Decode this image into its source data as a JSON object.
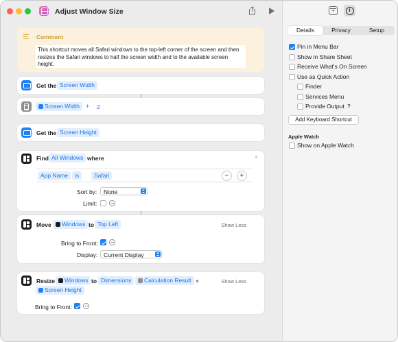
{
  "window": {
    "title": "Adjust Window Size"
  },
  "comment": {
    "title": "Comment",
    "text": "This shortcut moves all Safari windows to the top-left corner of the screen and then resizes the Safari windows to half the screen width and to the available screen height."
  },
  "actions": {
    "get_width": {
      "verb": "Get the",
      "param": "Screen Width"
    },
    "calc": {
      "var": "Screen Width",
      "op": "+",
      "value": "2"
    },
    "get_height": {
      "verb": "Get the",
      "param": "Screen Height"
    },
    "find": {
      "verb": "Find",
      "param": "All Windows",
      "suffix": "where",
      "cond_field": "App Name",
      "cond_op": "is",
      "cond_value": "Safari",
      "minus": "−",
      "plus": "+",
      "sort_label": "Sort by:",
      "sort_value": "None",
      "limit_label": "Limit:",
      "close": "×"
    },
    "move": {
      "verb": "Move",
      "param": "Windows",
      "to": "to",
      "position": "Top Left",
      "show_less": "Show Less",
      "front_label": "Bring to Front:",
      "display_label": "Display:",
      "display_value": "Current Display"
    },
    "resize": {
      "verb": "Resize",
      "param": "Windows",
      "to": "to",
      "mode": "Dimensions",
      "var1": "Calculation Result",
      "times": "×",
      "var2": "Screen Height",
      "show_less": "Show Less",
      "front_label": "Bring to Front:"
    }
  },
  "inspector": {
    "tabs": [
      "Details",
      "Privacy",
      "Setup"
    ],
    "active_tab": "Details",
    "options": {
      "pin_menu_bar": {
        "label": "Pin in Menu Bar",
        "checked": true
      },
      "share_sheet": {
        "label": "Show in Share Sheet",
        "checked": false
      },
      "whats_on_screen": {
        "label": "Receive What's On Screen",
        "checked": false
      },
      "quick_action": {
        "label": "Use as Quick Action",
        "checked": false
      },
      "finder": {
        "label": "Finder",
        "checked": false
      },
      "services_menu": {
        "label": "Services Menu",
        "checked": false
      },
      "provide_output": {
        "label": "Provide Output",
        "checked": false,
        "help": "?"
      }
    },
    "shortcut_button": "Add Keyboard Shortcut",
    "watch_section": "Apple Watch",
    "watch_option": {
      "label": "Show on Apple Watch",
      "checked": false
    }
  },
  "colors": {
    "accent": "#1f82f2",
    "token_bg": "#e3eefc",
    "comment_bg": "#fbf1dc",
    "comment_title": "#d49a1f"
  }
}
